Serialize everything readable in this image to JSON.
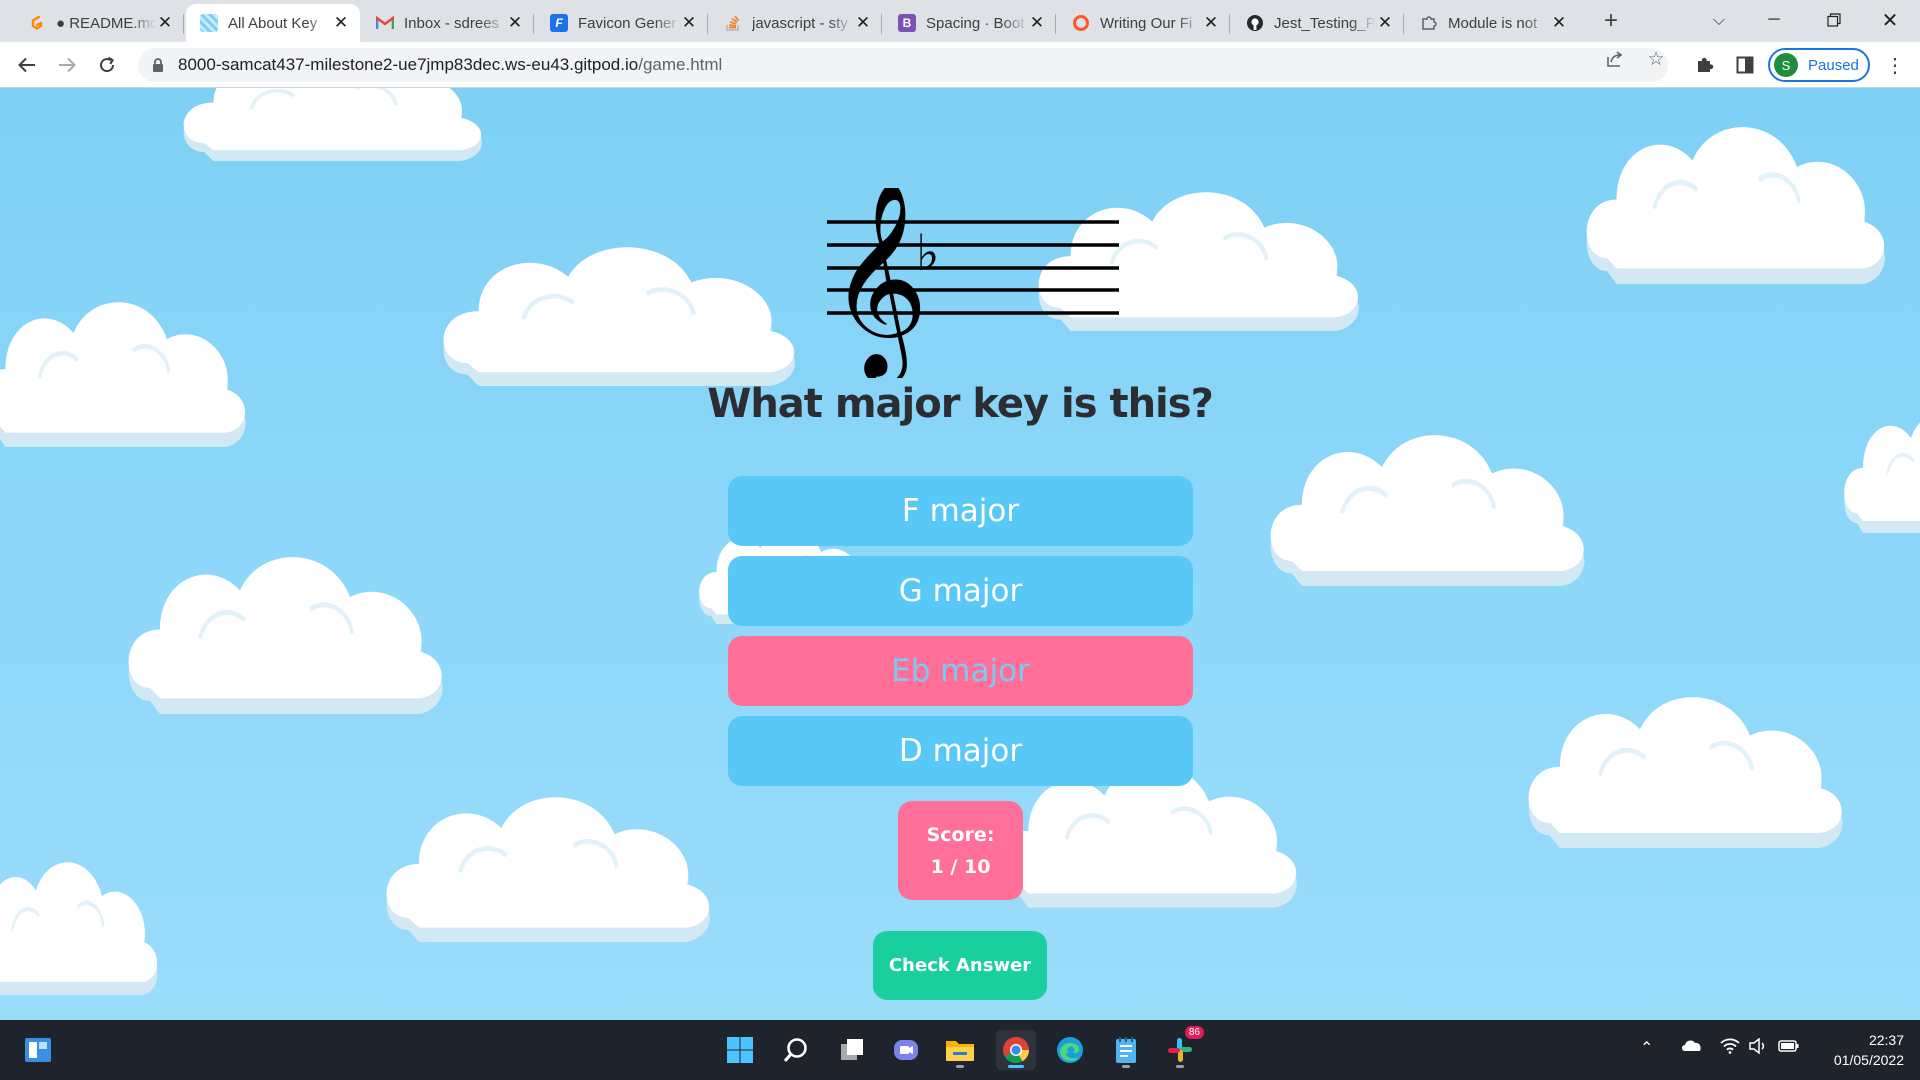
{
  "browser": {
    "tabs": [
      {
        "title": "● README.md",
        "favicon": "gitpod-icon",
        "color": "#ff8a00",
        "active": false
      },
      {
        "title": "All About Key",
        "favicon": "clouds-favicon-icon",
        "color": "#7fd0f5",
        "active": true
      },
      {
        "title": "Inbox - sdrees",
        "favicon": "gmail-icon",
        "color": "#ea4335",
        "active": false
      },
      {
        "title": "Favicon Gener",
        "favicon": "favicon-generator-icon",
        "color": "#1a73e8",
        "active": false
      },
      {
        "title": "javascript - sty",
        "favicon": "stackoverflow-icon",
        "color": "#f48024",
        "active": false
      },
      {
        "title": "Spacing · Boot",
        "favicon": "bootstrap-icon",
        "color": "#7952b3",
        "active": false
      },
      {
        "title": "Writing Our Fi",
        "favicon": "ring-icon",
        "color": "#ff5722",
        "active": false
      },
      {
        "title": "Jest_Testing_P",
        "favicon": "github-icon",
        "color": "#24292f",
        "active": false
      },
      {
        "title": "Module is not",
        "favicon": "puzzle-icon",
        "color": "#5f6368",
        "active": false
      }
    ],
    "url_host": "8000-samcat437-milestone2-ue7jmp83dec.ws-eu43.gitpod.io",
    "url_path": "/game.html",
    "profile_initial": "S",
    "profile_status": "Paused"
  },
  "game": {
    "key_signature": "F major (one flat)",
    "question": "What major key is this?",
    "answers": [
      {
        "label": "F major",
        "selected": false
      },
      {
        "label": "G major",
        "selected": false
      },
      {
        "label": "Eb major",
        "selected": true
      },
      {
        "label": "D major",
        "selected": false
      }
    ],
    "score_label": "Score:",
    "score_value": "1 / 10",
    "check_label": "Check Answer"
  },
  "taskbar": {
    "apps": [
      "windows-start-icon",
      "search-icon",
      "task-view-icon",
      "teams-chat-icon",
      "file-explorer-icon",
      "chrome-icon",
      "edge-icon",
      "notepad-icon",
      "slack-icon"
    ],
    "slack_badge": "86",
    "time": "22:37",
    "date": "01/05/2022"
  }
}
